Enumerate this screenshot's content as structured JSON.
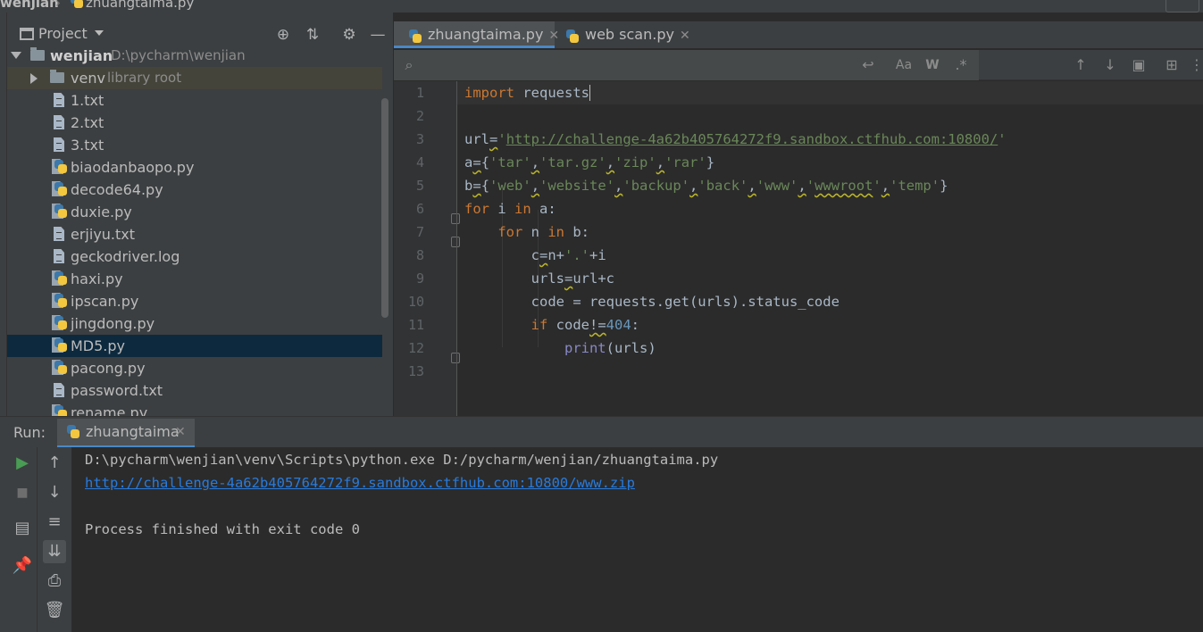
{
  "breadcrumb": {
    "project": "wenjian",
    "file": "zhuangtaima.py"
  },
  "project_panel": {
    "title": "Project",
    "root": {
      "name": "wenjian",
      "path": "D:\\pycharm\\wenjian"
    },
    "venv": {
      "name": "venv",
      "hint": "library root"
    },
    "files": [
      {
        "name": "1.txt",
        "type": "txt"
      },
      {
        "name": "2.txt",
        "type": "txt"
      },
      {
        "name": "3.txt",
        "type": "txt"
      },
      {
        "name": "biaodanbaopo.py",
        "type": "py"
      },
      {
        "name": "decode64.py",
        "type": "py"
      },
      {
        "name": "duxie.py",
        "type": "py"
      },
      {
        "name": "erjiyu.txt",
        "type": "txt"
      },
      {
        "name": "geckodriver.log",
        "type": "txt"
      },
      {
        "name": "haxi.py",
        "type": "py"
      },
      {
        "name": "ipscan.py",
        "type": "py"
      },
      {
        "name": "jingdong.py",
        "type": "py"
      },
      {
        "name": "MD5.py",
        "type": "py",
        "selected": true
      },
      {
        "name": "pacong.py",
        "type": "py"
      },
      {
        "name": "password.txt",
        "type": "txt"
      },
      {
        "name": "rename.py",
        "type": "py"
      }
    ],
    "icons": [
      "locate-icon",
      "collapse-all-icon",
      "gear-icon",
      "minimize-icon"
    ]
  },
  "editor": {
    "tabs": [
      {
        "label": "zhuangtaima.py",
        "active": true
      },
      {
        "label": "web scan.py",
        "active": false
      }
    ],
    "line_numbers": [
      "1",
      "2",
      "3",
      "4",
      "5",
      "6",
      "7",
      "8",
      "9",
      "10",
      "11",
      "12",
      "13"
    ]
  },
  "run": {
    "label": "Run:",
    "tab": "zhuangtaima",
    "console": {
      "command": "D:\\pycharm\\wenjian\\venv\\Scripts\\python.exe D:/pycharm/wenjian/zhuangtaima.py",
      "link": "http://challenge-4a62b405764272f9.sandbox.ctfhub.com:10800/www.zip",
      "exit": "Process finished with exit code 0"
    }
  },
  "colors": {
    "background": "#2b2b2b",
    "panel": "#3c3f41",
    "selection": "#0d293e",
    "keyword": "#cc7832",
    "string": "#6a8759",
    "number": "#6897bb",
    "link": "#287bde",
    "accent": "#4a88c7"
  }
}
